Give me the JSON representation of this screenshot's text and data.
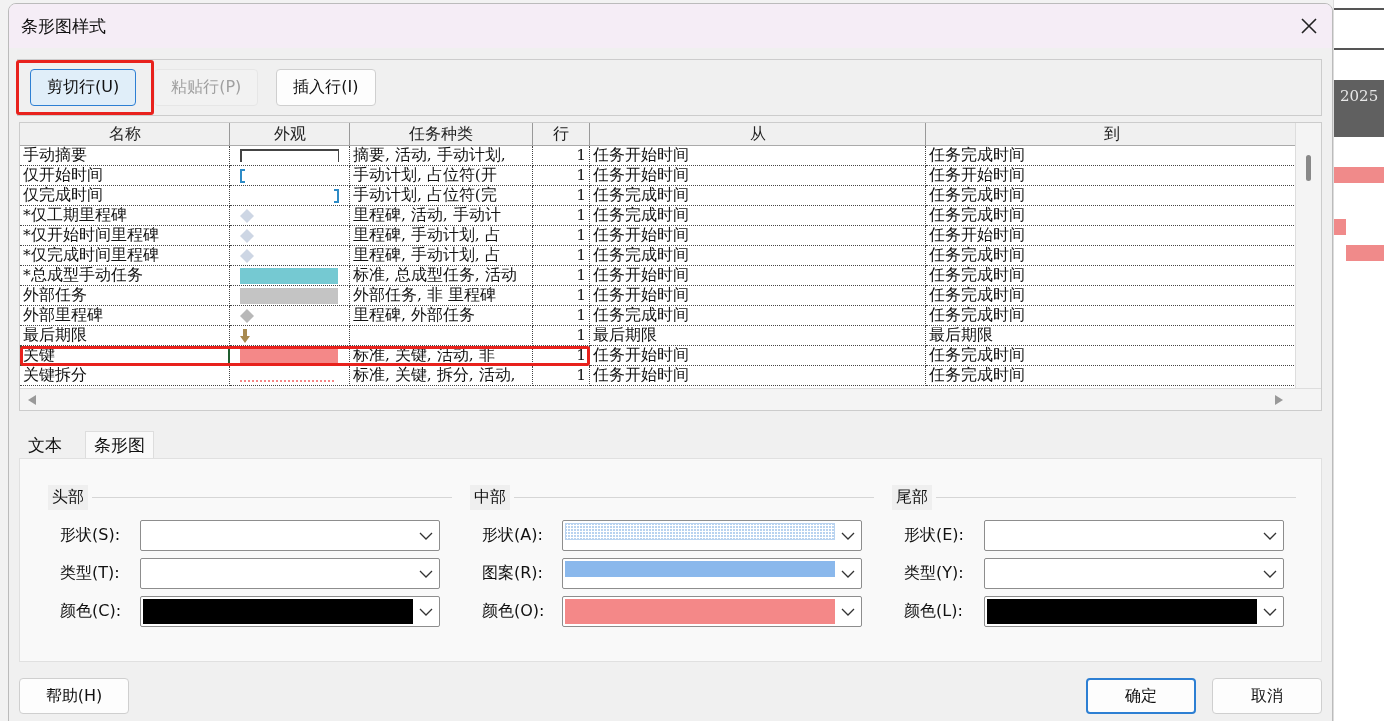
{
  "window": {
    "title": "条形图样式"
  },
  "toolbar": [
    {
      "label": "剪切行(U)",
      "selected": true,
      "disabled": false,
      "highlighted": true
    },
    {
      "label": "粘贴行(P)",
      "selected": false,
      "disabled": true,
      "highlighted": false
    },
    {
      "label": "插入行(I)",
      "selected": false,
      "disabled": false,
      "highlighted": false
    }
  ],
  "table": {
    "columns": [
      "名称",
      "外观",
      "任务种类",
      "行",
      "从",
      "到"
    ],
    "rows": [
      {
        "name": "手动摘要",
        "appearance": {
          "kind": "outline",
          "color": "#444444"
        },
        "task_types": "摘要, 活动, 手动计划,",
        "row": "1",
        "from": "任务开始时间",
        "to": "任务完成时间",
        "selected": false,
        "highlighted": false
      },
      {
        "name": "仅开始时间",
        "appearance": {
          "kind": "start-bracket",
          "color": "#2e8bc6"
        },
        "task_types": "手动计划, 占位符(开",
        "row": "1",
        "from": "任务开始时间",
        "to": "任务开始时间",
        "selected": false,
        "highlighted": false
      },
      {
        "name": "仅完成时间",
        "appearance": {
          "kind": "end-bracket",
          "color": "#2e8bc6"
        },
        "task_types": "手动计划, 占位符(完",
        "row": "1",
        "from": "任务完成时间",
        "to": "任务完成时间",
        "selected": false,
        "highlighted": false
      },
      {
        "name": "*仅工期里程碑",
        "appearance": {
          "kind": "diamond",
          "color": "#cdd6e4"
        },
        "task_types": "里程碑, 活动, 手动计",
        "row": "1",
        "from": "任务完成时间",
        "to": "任务完成时间",
        "selected": false,
        "highlighted": false
      },
      {
        "name": "*仅开始时间里程碑",
        "appearance": {
          "kind": "diamond",
          "color": "#cdd6e4"
        },
        "task_types": "里程碑, 手动计划, 占",
        "row": "1",
        "from": "任务开始时间",
        "to": "任务开始时间",
        "selected": false,
        "highlighted": false
      },
      {
        "name": "*仅完成时间里程碑",
        "appearance": {
          "kind": "diamond",
          "color": "#cdd6e4"
        },
        "task_types": "里程碑, 手动计划, 占",
        "row": "1",
        "from": "任务完成时间",
        "to": "任务完成时间",
        "selected": false,
        "highlighted": false
      },
      {
        "name": "*总成型手动任务",
        "appearance": {
          "kind": "bar",
          "color": "#75c9d2"
        },
        "task_types": "标准, 总成型任务, 活动",
        "row": "1",
        "from": "任务开始时间",
        "to": "任务完成时间",
        "selected": false,
        "highlighted": false
      },
      {
        "name": "外部任务",
        "appearance": {
          "kind": "bar",
          "color": "#c4c4c4"
        },
        "task_types": "外部任务, 非  里程碑",
        "row": "1",
        "from": "任务开始时间",
        "to": "任务完成时间",
        "selected": false,
        "highlighted": false
      },
      {
        "name": "外部里程碑",
        "appearance": {
          "kind": "diamond",
          "color": "#b8b8b8"
        },
        "task_types": "里程碑, 外部任务",
        "row": "1",
        "from": "任务完成时间",
        "to": "任务完成时间",
        "selected": false,
        "highlighted": false
      },
      {
        "name": "最后期限",
        "appearance": {
          "kind": "deadline",
          "color": "#a88a50"
        },
        "row": "1",
        "from": "最后期限",
        "to": "最后期限",
        "selected": false,
        "highlighted": false
      },
      {
        "name": "关键",
        "appearance": {
          "kind": "bar",
          "color": "#f48888"
        },
        "task_types": "标准, 关键, 活动, 非",
        "row": "1",
        "from": "任务开始时间",
        "to": "任务完成时间",
        "selected": true,
        "highlighted": true
      },
      {
        "name": "关键拆分",
        "appearance": {
          "kind": "dotted",
          "color": "#f48888"
        },
        "task_types": "标准, 关键, 拆分, 活动,",
        "row": "1",
        "from": "任务开始时间",
        "to": "任务完成时间",
        "selected": false,
        "highlighted": false
      }
    ]
  },
  "tabs": [
    {
      "label": "文本",
      "selected": false
    },
    {
      "label": "条形图",
      "selected": true
    }
  ],
  "groups": [
    {
      "title": "头部",
      "fields": [
        {
          "label": "形状(S):",
          "swatch": {
            "kind": "none"
          }
        },
        {
          "label": "类型(T):",
          "swatch": {
            "kind": "none"
          }
        },
        {
          "label": "颜色(C):",
          "swatch": {
            "kind": "solid",
            "color": "#000000"
          }
        }
      ]
    },
    {
      "title": "中部",
      "fields": [
        {
          "label": "形状(A):",
          "swatch": {
            "kind": "hatched",
            "color": "#b9d3f0"
          }
        },
        {
          "label": "图案(R):",
          "swatch": {
            "kind": "band",
            "color": "#8ab8ec"
          }
        },
        {
          "label": "颜色(O):",
          "swatch": {
            "kind": "solid",
            "color": "#f48888"
          }
        }
      ]
    },
    {
      "title": "尾部",
      "fields": [
        {
          "label": "形状(E):",
          "swatch": {
            "kind": "none"
          }
        },
        {
          "label": "类型(Y):",
          "swatch": {
            "kind": "none"
          }
        },
        {
          "label": "颜色(L):",
          "swatch": {
            "kind": "solid",
            "color": "#000000"
          }
        }
      ]
    }
  ],
  "footer": {
    "left": [
      {
        "label": "帮助(H)",
        "default": false
      }
    ],
    "right": [
      {
        "label": "确定",
        "default": true
      },
      {
        "label": "取消",
        "default": false
      }
    ]
  },
  "background": {
    "year": "2025"
  }
}
